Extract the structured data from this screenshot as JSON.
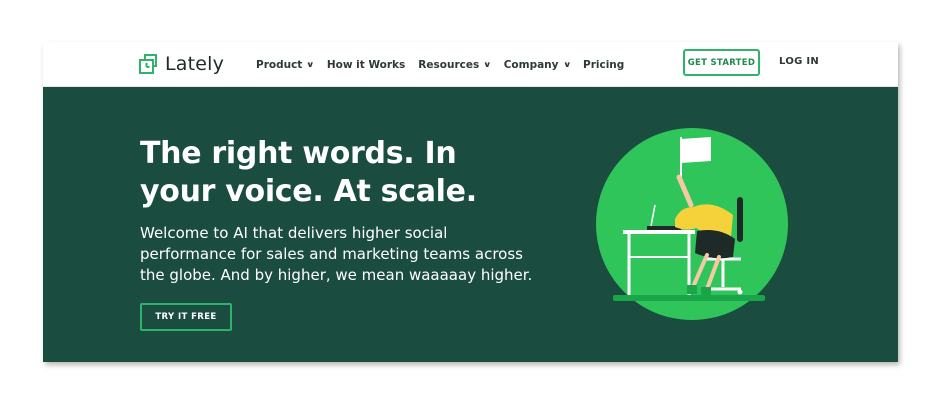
{
  "brand": {
    "name": "Lately",
    "accent": "#2fb36a",
    "hero_bg": "#1a4c40"
  },
  "nav": {
    "items": [
      {
        "label": "Product",
        "dropdown": true
      },
      {
        "label": "How it Works",
        "dropdown": false
      },
      {
        "label": "Resources",
        "dropdown": true
      },
      {
        "label": "Company",
        "dropdown": true
      },
      {
        "label": "Pricing",
        "dropdown": false
      }
    ],
    "get_started": "GET STARTED",
    "login": "LOG IN"
  },
  "hero": {
    "headline_line1": "The right words. In",
    "headline_line2": "your voice. At scale.",
    "sub_line1": "Welcome to AI that delivers higher social",
    "sub_line2": "performance for sales and marketing teams across",
    "sub_line3": "the globe. And by higher, we mean waaaaay higher.",
    "try_label": "TRY IT FREE"
  },
  "illustration": {
    "icon": "person-waving-white-flag-at-desk"
  }
}
